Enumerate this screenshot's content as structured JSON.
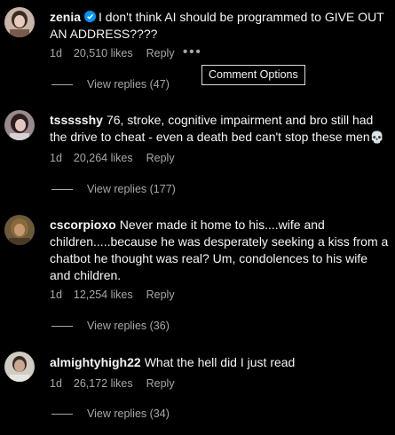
{
  "comments": [
    {
      "username": "zenia",
      "verified": true,
      "text": "I don't think AI should be programmed to GIVE OUT AN ADDRESS????",
      "time": "1d",
      "likes": "20,510 likes",
      "reply": "Reply",
      "view_replies": "View replies (47)",
      "more_icon": "•••"
    },
    {
      "username": "tssssshy",
      "verified": false,
      "text": "76, stroke, cognitive impairment and bro still had the drive to cheat - even a death bed can't stop these men",
      "emoji": "💀",
      "time": "1d",
      "likes": "20,264 likes",
      "reply": "Reply",
      "view_replies": "View replies (177)"
    },
    {
      "username": "cscorpioxo",
      "verified": false,
      "text": "Never made it home to his....wife and children.....because he was desperately seeking a kiss from a chatbot he thought was real? Um, condolences to his wife and children.",
      "time": "1d",
      "likes": "12,254 likes",
      "reply": "Reply",
      "view_replies": "View replies (36)"
    },
    {
      "username": "almightyhigh22",
      "verified": false,
      "text": "What the hell did I just read",
      "time": "1d",
      "likes": "26,172 likes",
      "reply": "Reply",
      "view_replies": "View replies (34)"
    }
  ],
  "tooltip": {
    "text": "Comment Options"
  },
  "colors": {
    "background": "#000000",
    "text": "#f5f5f5",
    "muted": "#a8a8a8",
    "verified": "#0095f6"
  }
}
